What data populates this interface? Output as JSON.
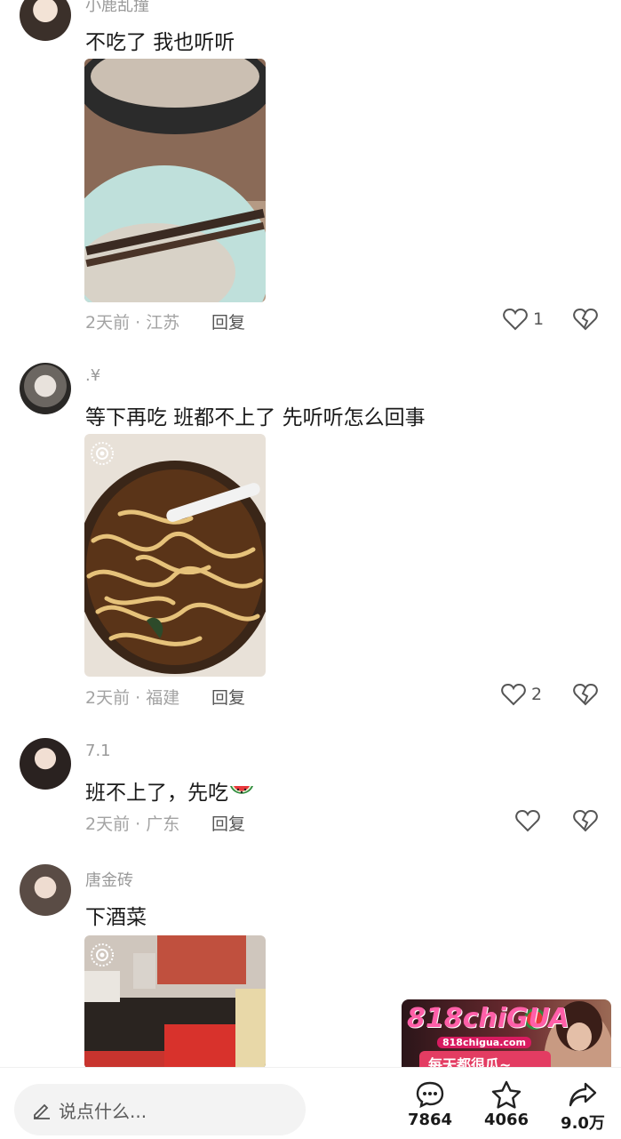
{
  "comments": [
    {
      "username": "小鹿乱撞",
      "text": "不吃了 我也听听",
      "time": "2天前 · 江苏",
      "reply": "回复",
      "likes": "1"
    },
    {
      "username": ".¥",
      "text": "等下再吃 班都不上了 先听听怎么回事",
      "time": "2天前 · 福建",
      "reply": "回复",
      "likes": "2"
    },
    {
      "username": "7.1",
      "text": "班不上了，先吃",
      "time": "2天前 · 广东",
      "reply": "回复",
      "likes": ""
    },
    {
      "username": "唐金砖",
      "text": "下酒菜"
    }
  ],
  "bottom_bar": {
    "input_placeholder": "说点什么...",
    "comments_count": "7864",
    "stars_count": "4066",
    "shares_count": "9.0万"
  },
  "ad": {
    "logo": "818chiGUA",
    "site": "818chigua.com",
    "slogan": "每天都很瓜~"
  }
}
